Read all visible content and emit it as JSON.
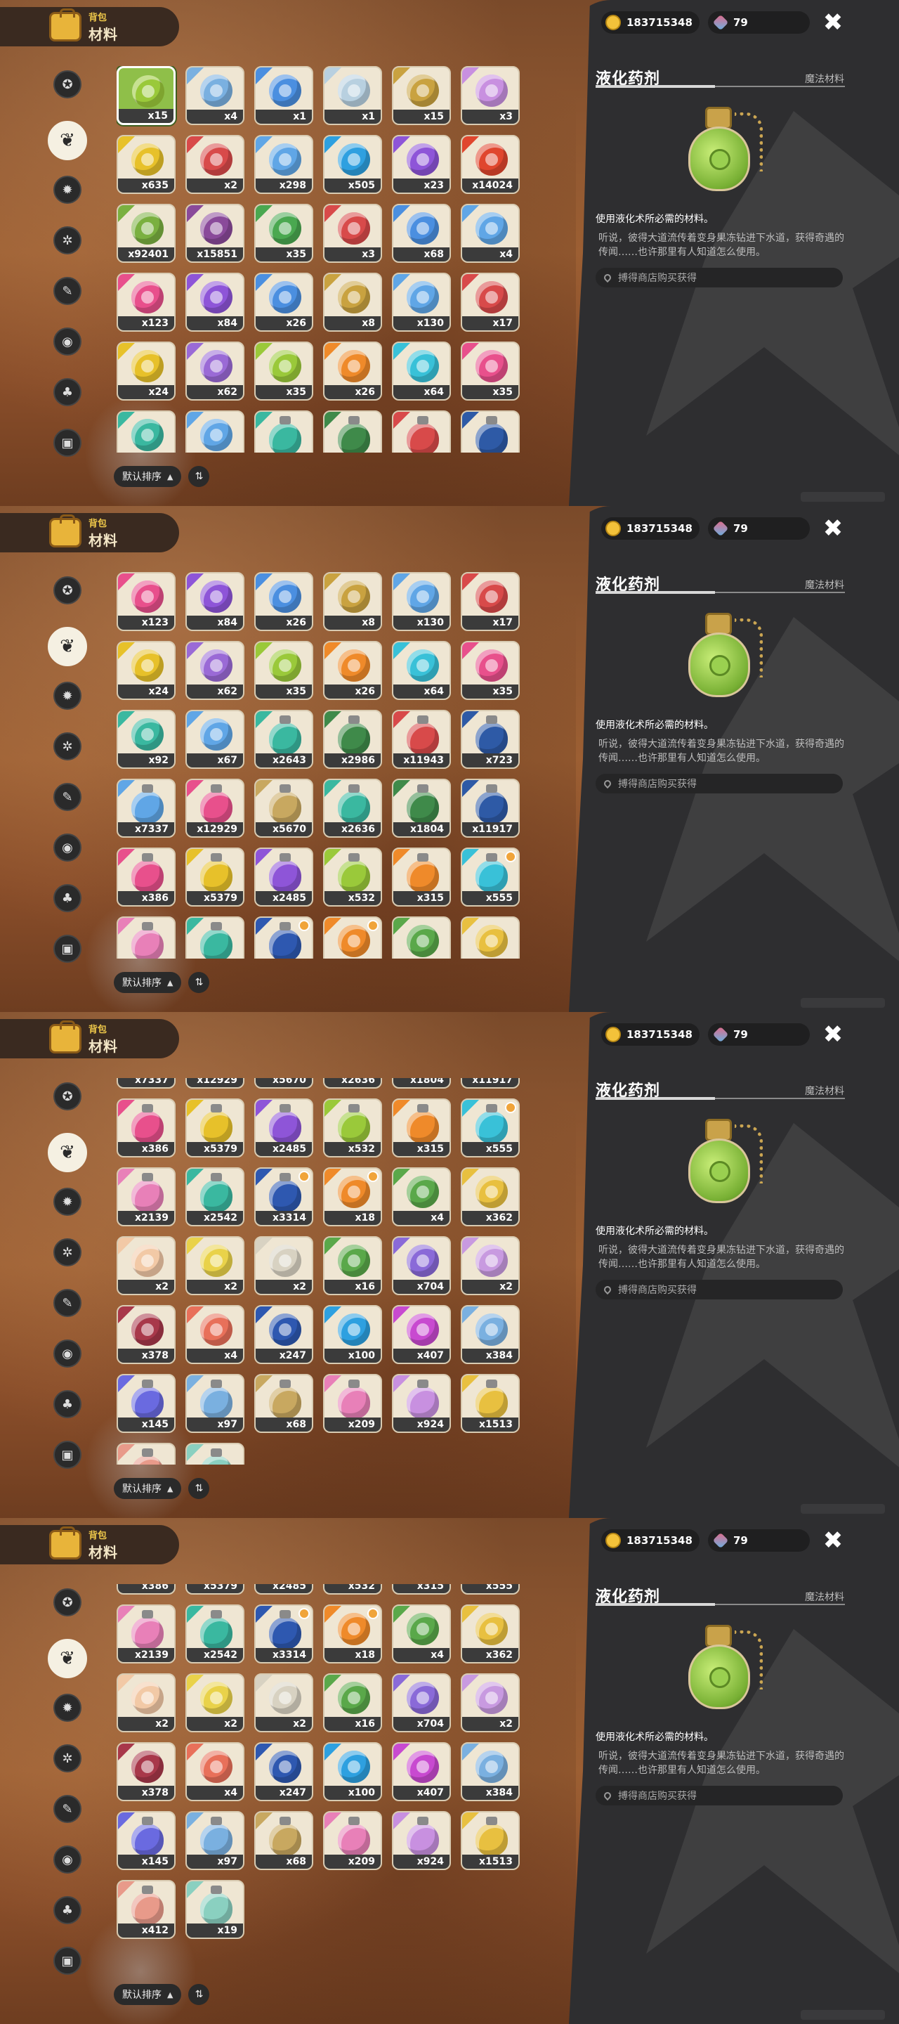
{
  "header": {
    "bag_label": "背包",
    "section_label": "材料"
  },
  "currency": {
    "gold": "183715348",
    "gems": "79"
  },
  "detail": {
    "item_name": "液化药剂",
    "item_type": "魔法材料",
    "description": "使用液化术所必需的材料。",
    "flavor": "听说，彼得大道流传着变身果冻钻进下水道，获得奇遇的传闻……也许那里有人知道怎么使用。",
    "source": "搏得商店购买获得",
    "icon": "green-potion-pendant-icon"
  },
  "sort": {
    "label": "默认排序",
    "arrow": "▲",
    "reverse_icon": "⇅"
  },
  "sidebar": [
    "star-icon",
    "leaf-icon",
    "gear-icon",
    "bug-icon",
    "scroll-icon",
    "globe-icon",
    "acorn-icon",
    "chest-icon"
  ],
  "colors": {
    "pink": "#e8508c",
    "purple": "#8e55d8",
    "blue": "#4b8fe0",
    "gold": "#c9a240",
    "red": "#d84a4a",
    "yellow": "#e7c12a",
    "violet": "#9a6ad6",
    "lime": "#9ac93a",
    "orange": "#ef8a2a",
    "cyan": "#39c1d8",
    "teal": "#3ab8a0",
    "sky": "#60a6e6",
    "green": "#4aa850",
    "dkgreen": "#3f8a4a",
    "navy": "#2e5aa6",
    "apple": "#e0462e",
    "olive": "#7ab040",
    "grape": "#8a4a9a",
    "cream": "#f2c9a6",
    "lemon": "#e9d24a",
    "bone": "#d8d2c2",
    "leafg": "#5aa84a",
    "lav": "#8a6ad8",
    "flower": "#c89ae0",
    "wine": "#a8384a",
    "coral": "#e8705a",
    "cobalt": "#2e58b0",
    "azure": "#2ea0e0",
    "magenta": "#c84ad0",
    "ice": "#7ab0e0",
    "periwinkle": "#6a6ae0",
    "pearl": "#b8d0e0",
    "amber": "#c8a860",
    "rose": "#e880b8",
    "lilac": "#c890e0",
    "sun": "#e8c040",
    "peach": "#e89a8a",
    "mint": "#8ad0c0"
  },
  "rows": [
    [
      {
        "c": "lime",
        "n": "x15",
        "sel": true
      },
      {
        "c": "ice",
        "n": "x4"
      },
      {
        "c": "blue",
        "n": "x1"
      },
      {
        "c": "pearl",
        "n": "x1"
      },
      {
        "c": "gold",
        "n": "x15"
      },
      {
        "c": "lilac",
        "n": "x3"
      }
    ],
    [
      {
        "c": "yellow",
        "n": "x635"
      },
      {
        "c": "red",
        "n": "x2"
      },
      {
        "c": "sky",
        "n": "x298"
      },
      {
        "c": "azure",
        "n": "x505"
      },
      {
        "c": "purple",
        "n": "x23"
      },
      {
        "c": "apple",
        "n": "x14024"
      }
    ],
    [
      {
        "c": "olive",
        "n": "x92401"
      },
      {
        "c": "grape",
        "n": "x15851"
      },
      {
        "c": "green",
        "n": "x35"
      },
      {
        "c": "red",
        "n": "x3"
      },
      {
        "c": "blue",
        "n": "x68"
      },
      {
        "c": "sky",
        "n": "x4"
      }
    ],
    [
      {
        "c": "pink",
        "n": "x123"
      },
      {
        "c": "purple",
        "n": "x84"
      },
      {
        "c": "blue",
        "n": "x26"
      },
      {
        "c": "gold",
        "n": "x8"
      },
      {
        "c": "sky",
        "n": "x130"
      },
      {
        "c": "red",
        "n": "x17"
      }
    ],
    [
      {
        "c": "yellow",
        "n": "x24"
      },
      {
        "c": "violet",
        "n": "x62"
      },
      {
        "c": "lime",
        "n": "x35"
      },
      {
        "c": "orange",
        "n": "x26"
      },
      {
        "c": "cyan",
        "n": "x64"
      },
      {
        "c": "pink",
        "n": "x35"
      }
    ],
    [
      {
        "c": "teal",
        "n": "x92"
      },
      {
        "c": "sky",
        "n": "x67"
      },
      {
        "c": "teal",
        "n": "x2643",
        "b": true
      },
      {
        "c": "dkgreen",
        "n": "x2986",
        "b": true
      },
      {
        "c": "red",
        "n": "x11943",
        "b": true
      },
      {
        "c": "navy",
        "n": "x723",
        "b": true
      }
    ],
    [
      {
        "c": "sky",
        "n": "x7337",
        "b": true
      },
      {
        "c": "pink",
        "n": "x12929",
        "b": true
      },
      {
        "c": "amber",
        "n": "x5670",
        "b": true
      },
      {
        "c": "teal",
        "n": "x2636",
        "b": true
      },
      {
        "c": "dkgreen",
        "n": "x1804",
        "b": true
      },
      {
        "c": "navy",
        "n": "x11917",
        "b": true
      }
    ],
    [
      {
        "c": "pink",
        "n": "x386",
        "b": true
      },
      {
        "c": "yellow",
        "n": "x5379",
        "b": true
      },
      {
        "c": "purple",
        "n": "x2485",
        "b": true
      },
      {
        "c": "lime",
        "n": "x532",
        "b": true
      },
      {
        "c": "orange",
        "n": "x315",
        "b": true
      },
      {
        "c": "cyan",
        "n": "x555",
        "b": true,
        "badge": true
      }
    ],
    [
      {
        "c": "rose",
        "n": "x2139",
        "b": true
      },
      {
        "c": "teal",
        "n": "x2542",
        "b": true
      },
      {
        "c": "cobalt",
        "n": "x3314",
        "b": true,
        "badge": true
      },
      {
        "c": "orange",
        "n": "x18",
        "badge": true
      },
      {
        "c": "leafg",
        "n": "x4"
      },
      {
        "c": "sun",
        "n": "x362"
      }
    ],
    [
      {
        "c": "cream",
        "n": "x2"
      },
      {
        "c": "lemon",
        "n": "x2"
      },
      {
        "c": "bone",
        "n": "x2"
      },
      {
        "c": "leafg",
        "n": "x16"
      },
      {
        "c": "lav",
        "n": "x704"
      },
      {
        "c": "flower",
        "n": "x2"
      }
    ],
    [
      {
        "c": "wine",
        "n": "x378"
      },
      {
        "c": "coral",
        "n": "x4"
      },
      {
        "c": "cobalt",
        "n": "x247"
      },
      {
        "c": "azure",
        "n": "x100"
      },
      {
        "c": "magenta",
        "n": "x407"
      },
      {
        "c": "ice",
        "n": "x384"
      }
    ],
    [
      {
        "c": "periwinkle",
        "n": "x145",
        "b": true
      },
      {
        "c": "ice",
        "n": "x97",
        "b": true
      },
      {
        "c": "amber",
        "n": "x68",
        "b": true
      },
      {
        "c": "rose",
        "n": "x209",
        "b": true
      },
      {
        "c": "lilac",
        "n": "x924",
        "b": true
      },
      {
        "c": "sun",
        "n": "x1513",
        "b": true
      }
    ],
    [
      {
        "c": "peach",
        "n": "x412",
        "b": true
      },
      {
        "c": "mint",
        "n": "x19",
        "b": true
      }
    ]
  ]
}
